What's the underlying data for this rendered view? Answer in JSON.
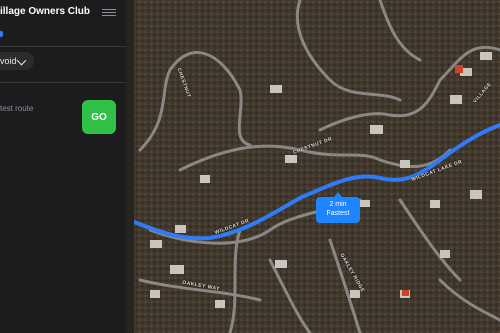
{
  "panel": {
    "title": "illage Owners Club",
    "avoid_label": "void",
    "route_subtitle": "test route",
    "go_label": "GO"
  },
  "route_callout": {
    "time": "2 min",
    "label": "Fastest"
  },
  "map_labels": {
    "cheston": "CHESTNUT",
    "chestnut_dr": "CHESTNUT DR",
    "wildcat_left": "WILDCAT DR",
    "wildcat_right": "WILDCAT LAKE DR",
    "oakley": "OAKLEY WAY",
    "village": "VILLAGE",
    "oakley_ridge": "OAKLEY RIDGE"
  },
  "colors": {
    "route_blue": "#2f7cf6",
    "go_green": "#30c048",
    "panel_bg": "#1c1c1e"
  }
}
